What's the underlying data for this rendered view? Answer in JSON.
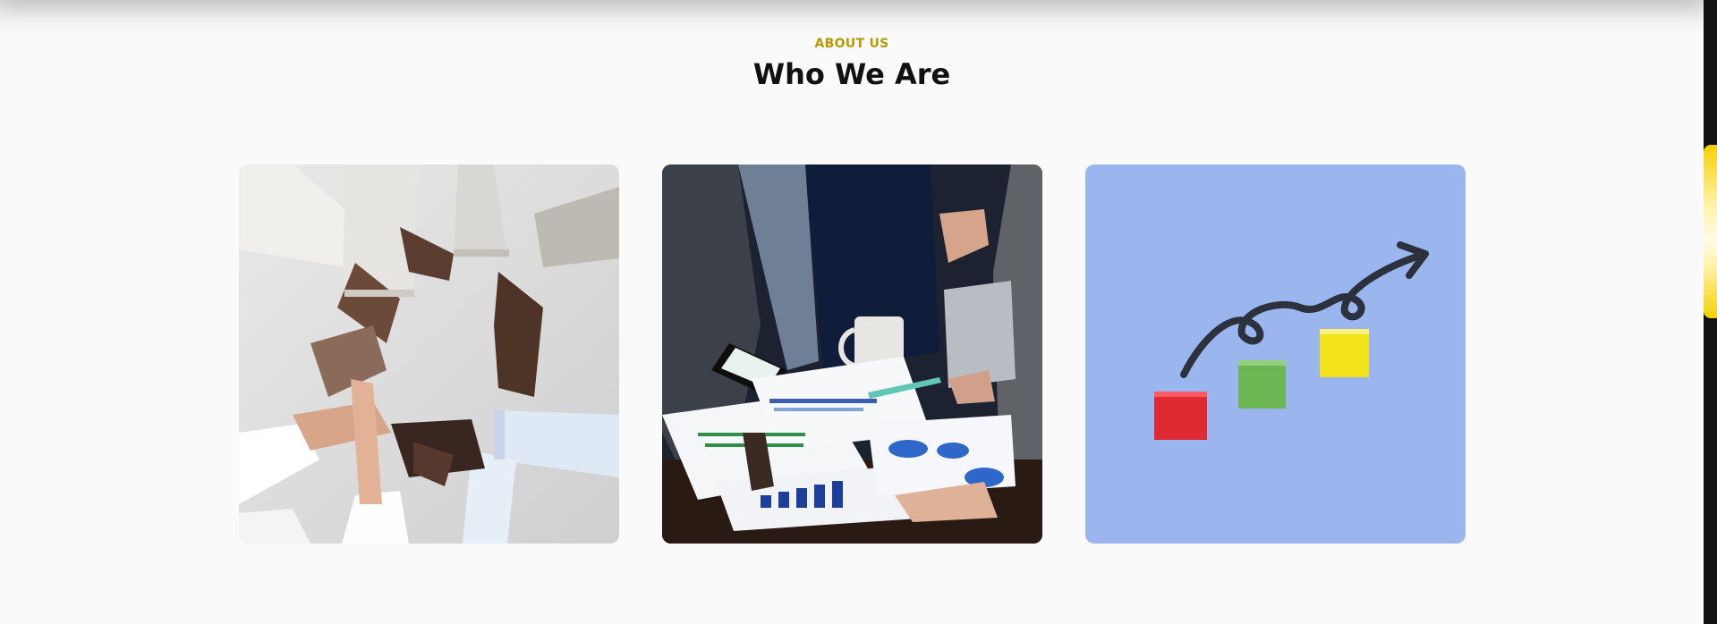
{
  "section": {
    "eyebrow": "ABOUT US",
    "title": "Who We Are"
  },
  "cards": [
    {
      "image": "hands-linked-teamwork"
    },
    {
      "image": "team-reviewing-charts-on-table"
    },
    {
      "image": "growth-blocks-with-arrow"
    }
  ],
  "colors": {
    "accent": "#b59b00",
    "background": "#fafafa",
    "card3_bg": "#9bb6ee",
    "block_red": "#e02a33",
    "block_green": "#6db654",
    "block_yellow": "#f2e21a"
  }
}
